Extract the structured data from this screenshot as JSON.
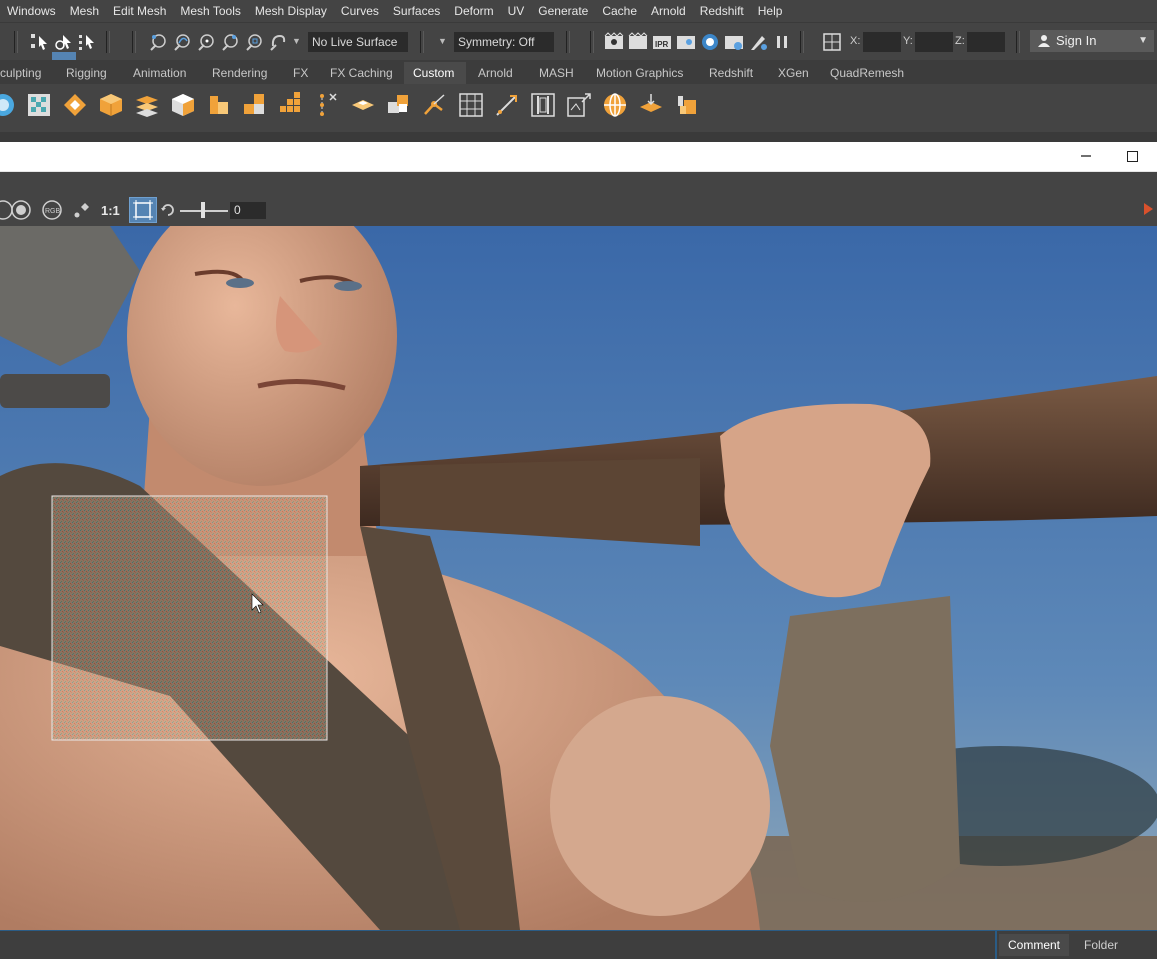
{
  "menubar": {
    "items": [
      "Windows",
      "Mesh",
      "Edit Mesh",
      "Mesh Tools",
      "Mesh Display",
      "Curves",
      "Surfaces",
      "Deform",
      "UV",
      "Generate",
      "Cache",
      "Arnold",
      "Redshift",
      "Help"
    ]
  },
  "statusline": {
    "live_surface": "No Live Surface",
    "symmetry": "Symmetry: Off",
    "coord_x_label": "X:",
    "coord_y_label": "Y:",
    "coord_z_label": "Z:",
    "sign_in": "Sign In"
  },
  "shelf_tabs": [
    "culpting",
    "Rigging",
    "Animation",
    "Rendering",
    "FX",
    "FX Caching",
    "Custom",
    "Arnold",
    "MASH",
    "Motion Graphics",
    "Redshift",
    "XGen",
    "QuadRemesh"
  ],
  "shelf_tab_active": "Custom",
  "render_view": {
    "ratio_label": "1:1",
    "exposure_value": "0",
    "rgb_label": "RGB"
  },
  "bottom_tabs": {
    "comment": "Comment",
    "folder": "Folder"
  },
  "colors": {
    "accent_blue": "#5584b3",
    "play_orange": "#d9512c",
    "icon_orange": "#f0a23a",
    "sky_top": "#3a68a8",
    "sky_bottom": "#7f9fb8"
  }
}
